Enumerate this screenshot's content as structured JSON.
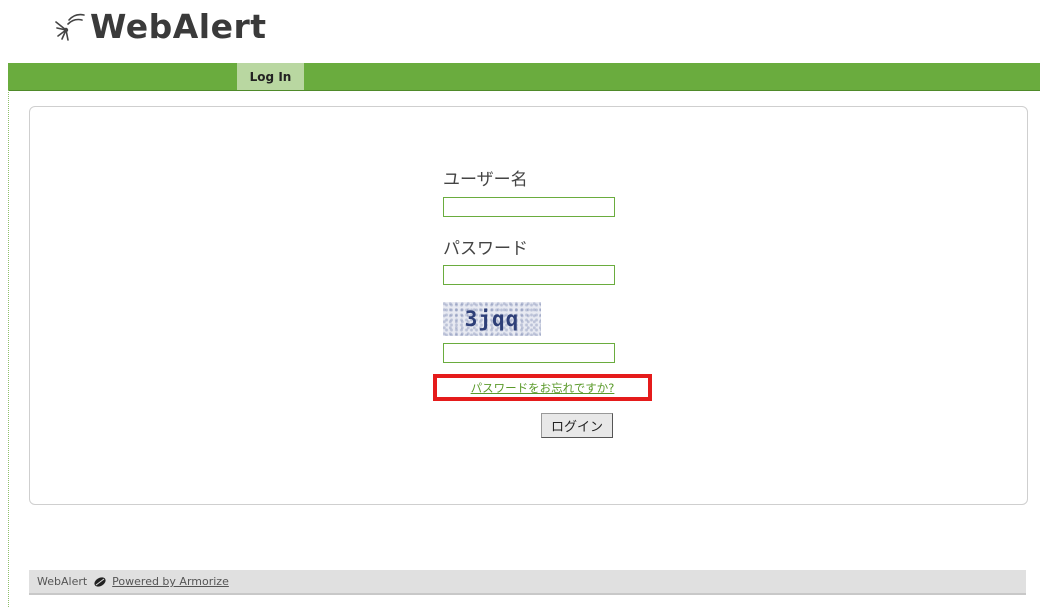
{
  "header": {
    "logo_text": "WebAlert",
    "logo_icon": "sparkle-logo-icon"
  },
  "nav": {
    "tabs": [
      {
        "label": "Log In",
        "active": true
      }
    ]
  },
  "login": {
    "username_label": "ユーザー名",
    "username_value": "",
    "password_label": "パスワード",
    "password_value": "",
    "captcha_text": "3jqq",
    "captcha_value": "",
    "forgot_link": "パスワードをお忘れですか?",
    "submit_label": "ログイン"
  },
  "footer": {
    "brand": "WebAlert",
    "powered_by": "Powered by Armorize",
    "icon": "armorize-leaf-icon"
  },
  "colors": {
    "nav_bar": "#6aac3e",
    "nav_tab_active": "#b9d7a1",
    "field_border": "#6aac3e",
    "highlight_box": "#e51b1b",
    "link": "#5a9a2a",
    "footer_bg": "#e0e0e0"
  }
}
